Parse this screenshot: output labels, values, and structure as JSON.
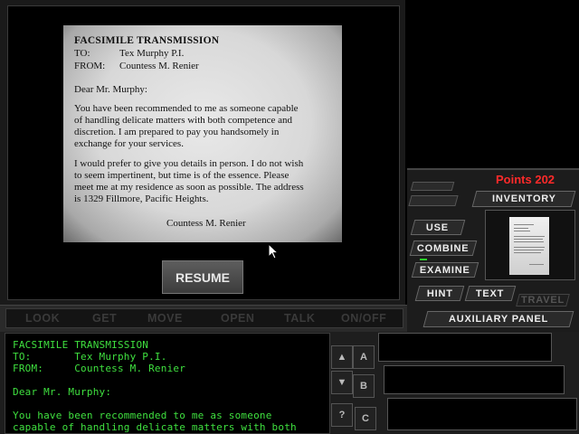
{
  "fax": {
    "title": "FACSIMILE TRANSMISSION",
    "to_label": "TO:",
    "to_value": "Tex Murphy P.I.",
    "from_label": "FROM:",
    "from_value": "Countess M. Renier",
    "greeting": "Dear Mr. Murphy:",
    "para1": [
      "You have been recommended to me as someone capable",
      "of handling delicate matters with both competence and",
      "discretion.   I am prepared to pay you handsomely in",
      "exchange for your services."
    ],
    "para2": [
      "I would prefer to give you details in person.  I do not wish",
      "to seem impertinent, but time is of the essence.  Please",
      "meet me at my residence as soon as possible.  The address",
      "is 1329 Fillmore, Pacific Heights."
    ],
    "signature": "Countess M. Renier"
  },
  "resume_label": "RESUME",
  "verbs": [
    "LOOK",
    "GET",
    "MOVE",
    "OPEN",
    "TALK",
    "ON/OFF"
  ],
  "points": "Points 202",
  "panel": {
    "inventory": "INVENTORY",
    "use": "USE",
    "combine": "COMBINE",
    "examine": "EXAMINE",
    "hint": "HINT",
    "text": "TEXT",
    "travel": "TRAVEL",
    "auxiliary": "AUXILIARY PANEL"
  },
  "console": {
    "line1": "FACSIMILE TRANSMISSION",
    "line2": "TO:       Tex Murphy P.I.",
    "line3": "FROM:     Countess M. Renier",
    "line4": "Dear Mr. Murphy:",
    "line5": "You have been recommended to me as someone",
    "line6": "capable of handling delicate matters with both"
  },
  "scroll": {
    "a": "A",
    "b": "B",
    "c": "C",
    "q": "?"
  },
  "colors": {
    "points": "#ff2a2a",
    "console_text": "#3fe03f"
  }
}
